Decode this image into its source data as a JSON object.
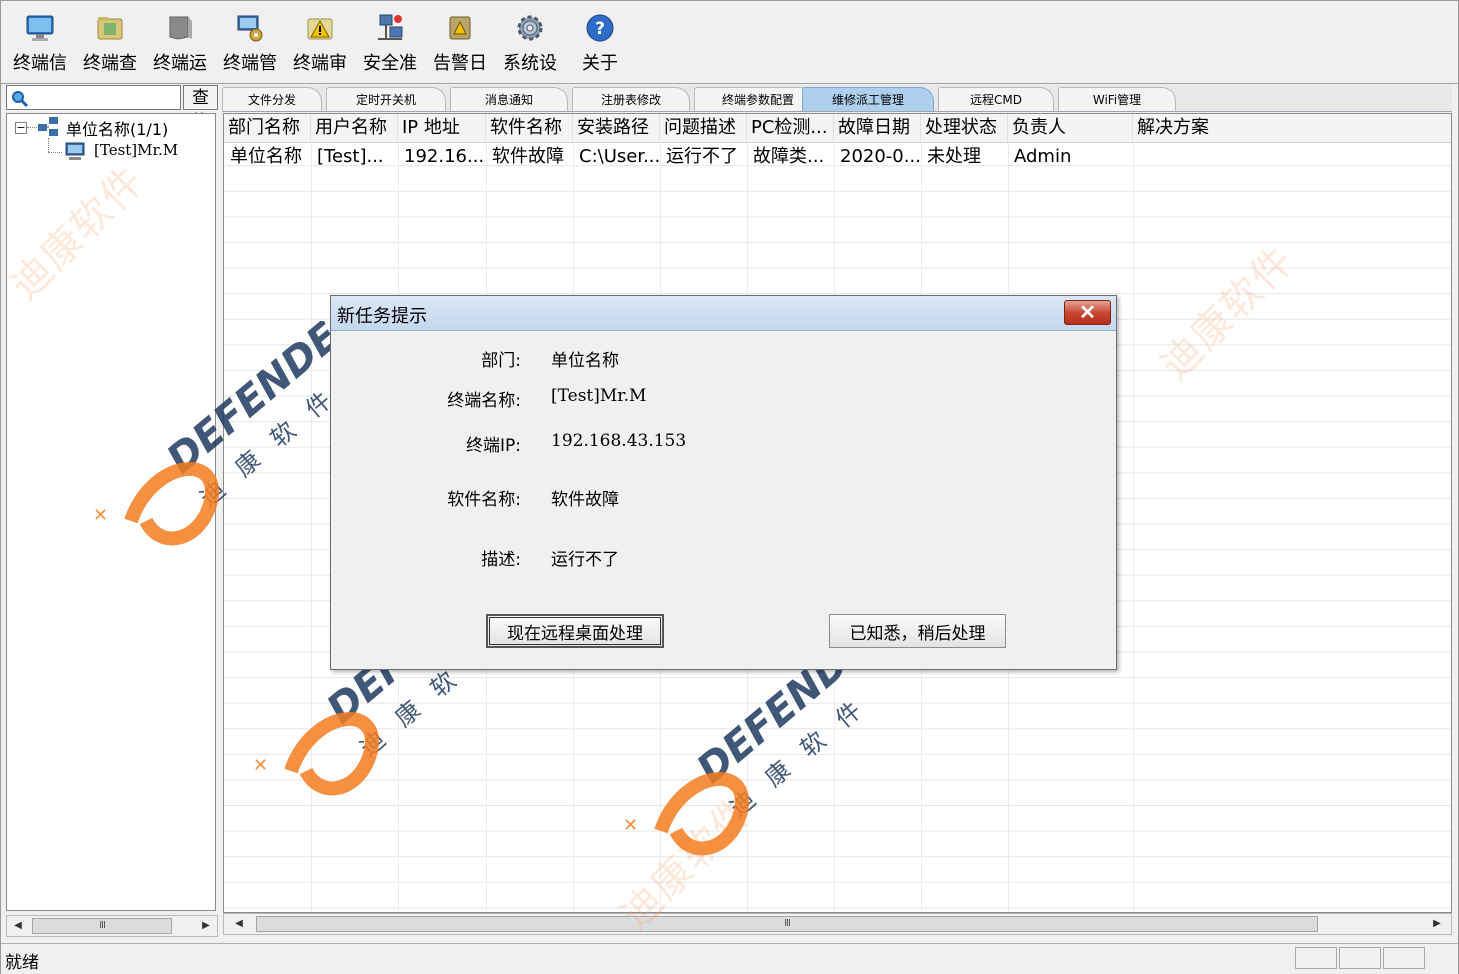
{
  "toolbar": {
    "items": [
      {
        "label": "终端信",
        "icon": "monitor-icon"
      },
      {
        "label": "终端查",
        "icon": "folder-search-icon"
      },
      {
        "label": "终端运",
        "icon": "book-icon"
      },
      {
        "label": "终端管",
        "icon": "computer-gear-icon"
      },
      {
        "label": "终端审",
        "icon": "warning-folder-icon"
      },
      {
        "label": "安全准",
        "icon": "network-shield-icon"
      },
      {
        "label": "告警日",
        "icon": "alarm-log-icon"
      },
      {
        "label": "系统设",
        "icon": "gear-icon"
      },
      {
        "label": "关于",
        "icon": "help-icon"
      }
    ]
  },
  "search": {
    "value": "",
    "placeholder": "",
    "button_label": "查找"
  },
  "tree": {
    "root_label": "单位名称(1/1)",
    "expander": "−",
    "child_label": "[Test]Mr.M"
  },
  "tabs": [
    {
      "label": "文件分发",
      "active": false
    },
    {
      "label": "定时开关机",
      "active": false
    },
    {
      "label": "消息通知",
      "active": false
    },
    {
      "label": "注册表修改",
      "active": false
    },
    {
      "label": "终端参数配置",
      "active": false
    },
    {
      "label": "维修派工管理",
      "active": true
    },
    {
      "label": "远程CMD",
      "active": false
    },
    {
      "label": "WiFi管理",
      "active": false
    }
  ],
  "table": {
    "columns": [
      "部门名称",
      "用户名称",
      "IP 地址",
      "软件名称",
      "安装路径",
      "问题描述",
      "PC检测...",
      "故障日期",
      "处理状态",
      "负责人",
      "解决方案"
    ],
    "rows": [
      [
        "单位名称",
        "[Test]...",
        "192.16...",
        "软件故障",
        "C:\\User...",
        "运行不了",
        "故障类...",
        "2020-0...",
        "未处理",
        "Admin",
        ""
      ]
    ]
  },
  "dialog": {
    "title": "新任务提示",
    "close_glyph": "✕",
    "fields": [
      {
        "label": "部门:",
        "value": "单位名称"
      },
      {
        "label": "终端名称:",
        "value": "[Test]Mr.M"
      },
      {
        "label": "终端IP:",
        "value": "192.168.43.153"
      },
      {
        "label": "软件名称:",
        "value": "软件故障"
      },
      {
        "label": "描述:",
        "value": "运行不了"
      }
    ],
    "primary_button": "现在远程桌面处理",
    "secondary_button": "已知悉，稍后处理"
  },
  "status": {
    "text": "就绪"
  },
  "watermark": {
    "brand": "DEFENDER",
    "cn_chars": [
      "迪",
      "康",
      "软",
      "件"
    ],
    "cn_text": "迪康软件",
    "accent": "#f47c20"
  },
  "scroll": {
    "thumb_glyph": "III",
    "left_arrow": "◀",
    "right_arrow": "▶"
  }
}
